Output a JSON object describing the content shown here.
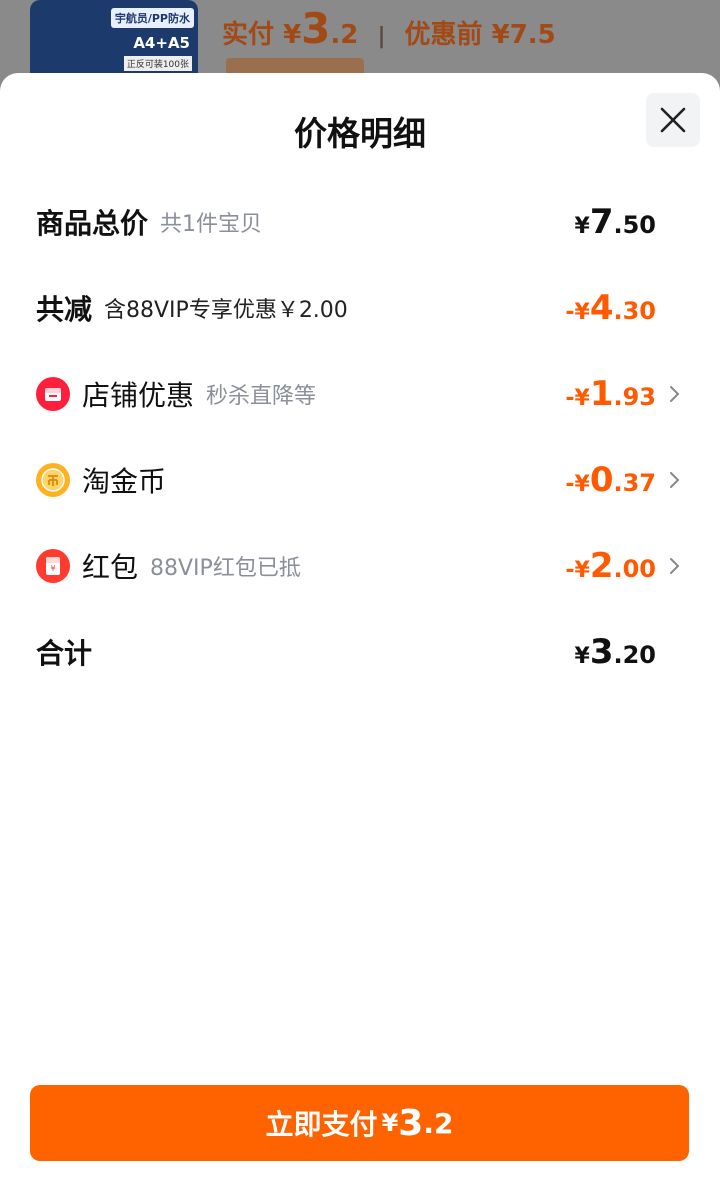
{
  "background": {
    "thumb_tag": "宇航员/PP防水",
    "thumb_size": "A4+A5",
    "thumb_caption": "正反可装100张",
    "price_label": "实付",
    "price_symbol": "¥",
    "price_int": "3",
    "price_dec": ".2",
    "orig_label": "优惠前",
    "orig_price": "¥7.5"
  },
  "sheet": {
    "title": "价格明细",
    "rows": {
      "total": {
        "label": "商品总价",
        "sub": "共1件宝贝",
        "sign": "¥",
        "int": "7",
        "dec": ".50"
      },
      "reduce": {
        "label": "共减",
        "sub": "含88VIP专享优惠￥2.00",
        "sign": "-¥",
        "int": "4",
        "dec": ".30"
      },
      "shop": {
        "label": "店铺优惠",
        "sub": "秒杀直降等",
        "sign": "-¥",
        "int": "1",
        "dec": ".93"
      },
      "coin": {
        "label": "淘金币",
        "sign": "-¥",
        "int": "0",
        "dec": ".37"
      },
      "redpack": {
        "label": "红包",
        "sub": "88VIP红包已抵",
        "sign": "-¥",
        "int": "2",
        "dec": ".00"
      },
      "sum": {
        "label": "合计",
        "sign": "¥",
        "int": "3",
        "dec": ".20"
      }
    },
    "pay_button": {
      "label": "立即支付",
      "sign": "¥",
      "int": "3",
      "dec": ".2"
    }
  },
  "colors": {
    "accent": "#ff6300",
    "discount": "#ff5a00",
    "shop_icon": "#ff1f3d",
    "coin_icon": "#ffb21f",
    "redpack_icon": "#ff3b30"
  }
}
